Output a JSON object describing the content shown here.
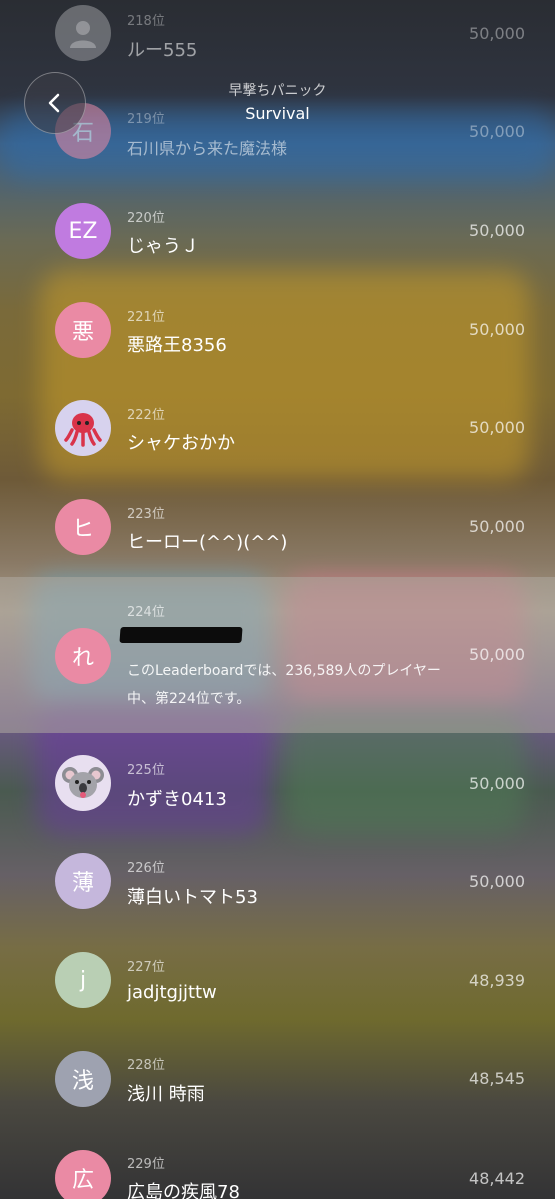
{
  "header": {
    "app_title": "早撃ちパニック",
    "leaderboard_name": "Survival"
  },
  "rows": [
    {
      "rank": "218位",
      "name": "ルー555",
      "score": "50,000",
      "avatar_text": "",
      "avatar_icon": "person-icon",
      "avatar_color": "#9a9ca0"
    },
    {
      "rank": "219位",
      "name": "石川県から来た魔法様",
      "score": "50,000",
      "avatar_text": "石",
      "avatar_color": "#e98aa6"
    },
    {
      "rank": "220位",
      "name": "じゃうＪ",
      "score": "50,000",
      "avatar_text": "EZ",
      "avatar_color": "#c07be0"
    },
    {
      "rank": "221位",
      "name": "悪路王8356",
      "score": "50,000",
      "avatar_text": "悪",
      "avatar_color": "#ea8aa4"
    },
    {
      "rank": "222位",
      "name": "シャケおかか",
      "score": "50,000",
      "avatar_text": "",
      "avatar_icon": "octopus-icon",
      "avatar_color": "#d7d2ee"
    },
    {
      "rank": "223位",
      "name": "ヒーロー(^^)(^^)",
      "score": "50,000",
      "avatar_text": "ヒ",
      "avatar_color": "#ea8aa4"
    },
    {
      "rank": "224位",
      "name": "",
      "score": "50,000",
      "avatar_text": "れ",
      "avatar_color": "#ea8aa4"
    },
    {
      "rank": "225位",
      "name": "かずき0413",
      "score": "50,000",
      "avatar_text": "",
      "avatar_icon": "koala-icon",
      "avatar_color": "#e8dff0"
    },
    {
      "rank": "226位",
      "name": "薄白いトマト53",
      "score": "50,000",
      "avatar_text": "薄",
      "avatar_color": "#c5b7dc"
    },
    {
      "rank": "227位",
      "name": "jadjtgjjttw",
      "score": "48,939",
      "avatar_text": "j",
      "avatar_color": "#b9cfb4"
    },
    {
      "rank": "228位",
      "name": "浅川 時雨",
      "score": "48,545",
      "avatar_text": "浅",
      "avatar_color": "#9ea2b0"
    },
    {
      "rank": "229位",
      "name": "広島の疾風78",
      "score": "48,442",
      "avatar_text": "広",
      "avatar_color": "#ea8aa4"
    }
  ],
  "player_summary": "このLeaderboardでは、236,589人のプレイヤー中、第224位です。"
}
